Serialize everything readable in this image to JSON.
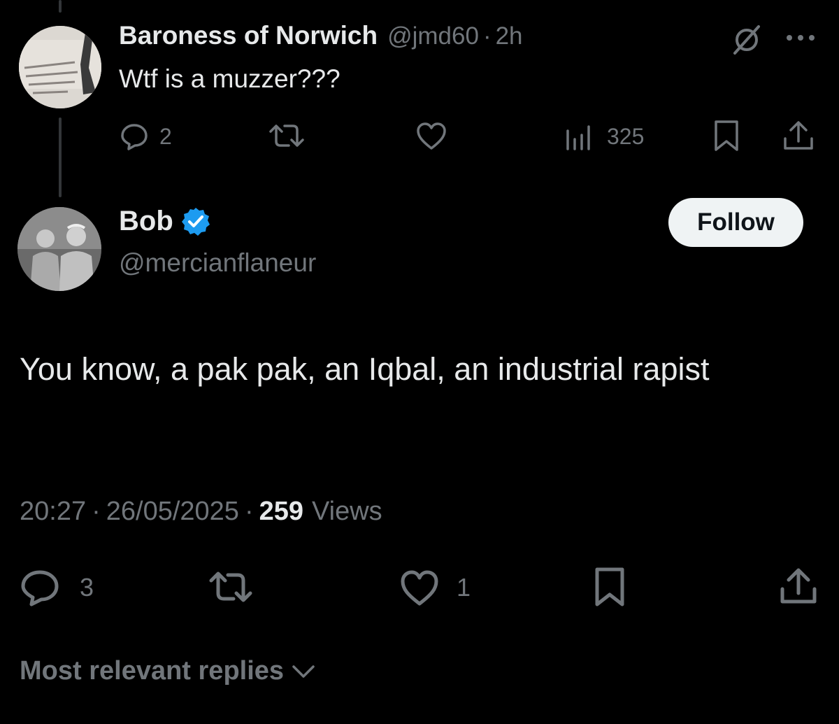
{
  "parent_tweet": {
    "display_name": "Baroness of Norwich",
    "handle": "@jmd60",
    "separator": "·",
    "time": "2h",
    "text": "Wtf is a muzzer???",
    "reply_count": "2",
    "view_count": "325",
    "icons": [
      "grok-slash-icon",
      "more-icon",
      "reply-icon",
      "retweet-icon",
      "like-icon",
      "views-icon",
      "bookmark-icon",
      "share-icon"
    ]
  },
  "main_tweet": {
    "display_name": "Bob",
    "handle": "@mercianflaneur",
    "follow_label": "Follow",
    "text": "You know, a pak pak, an Iqbal, an industrial rapist",
    "timestamp": "20:27",
    "sep1": "·",
    "date": "26/05/2025",
    "sep2": "·",
    "views_count": "259",
    "views_label": "Views",
    "reply_count": "3",
    "like_count": "1",
    "verified_color": "#1d9bf0"
  },
  "replies_sort": {
    "label": "Most relevant replies"
  },
  "colors": {
    "background": "#000000",
    "text": "#e7e9ea",
    "muted": "#71767b",
    "verified": "#1d9bf0"
  }
}
